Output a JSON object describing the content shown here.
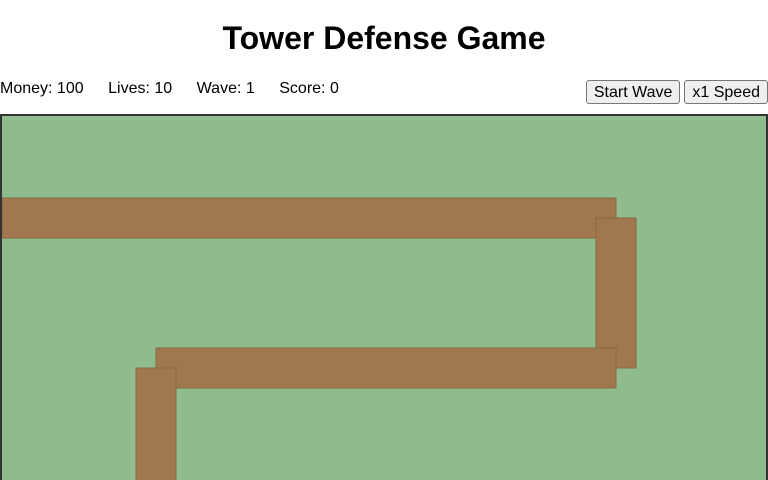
{
  "title": "Tower Defense Game",
  "hud": {
    "money": "Money: 100",
    "lives": "Lives: 10",
    "wave": "Wave: 1",
    "score": "Score: 0"
  },
  "controls": {
    "start_wave_label": "Start Wave",
    "speed_label": "x1 Speed"
  },
  "colors": {
    "grass": "#8fbc8f",
    "path": "#a0784e",
    "path_edge": "#8a6740",
    "border": "#333333"
  }
}
